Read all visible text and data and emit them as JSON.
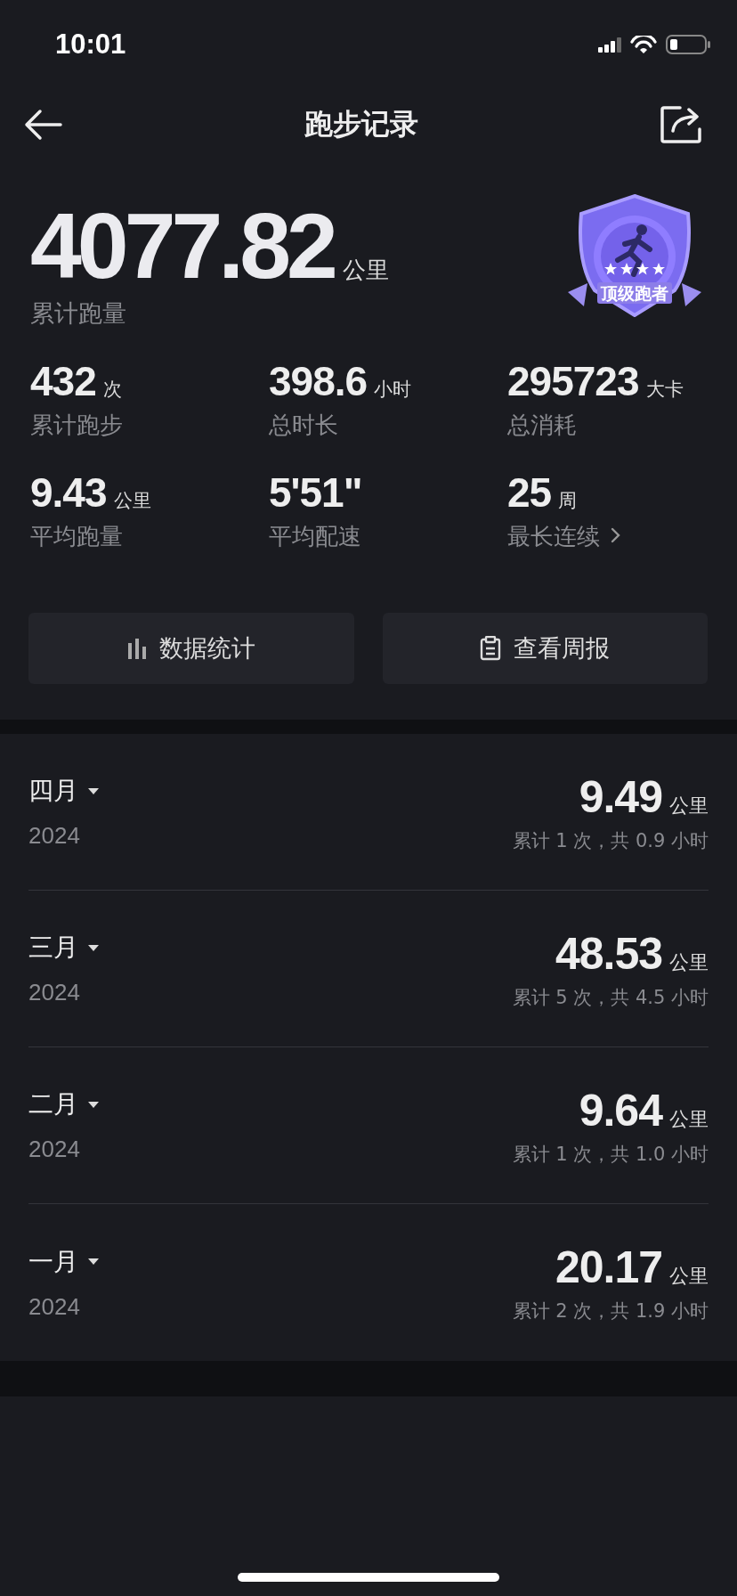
{
  "status_bar": {
    "time": "10:01"
  },
  "header": {
    "title": "跑步记录"
  },
  "summary": {
    "total": "4077.82",
    "unit": "公里",
    "label": "累计跑量",
    "badge": {
      "text": "顶级跑者"
    }
  },
  "stats": [
    {
      "value": "432",
      "unit": "次",
      "label": "累计跑步",
      "kind": "plain"
    },
    {
      "value": "398.6",
      "unit": "小时",
      "label": "总时长",
      "kind": "plain"
    },
    {
      "value": "295723",
      "unit": "大卡",
      "label": "总消耗",
      "kind": "plain"
    },
    {
      "value": "9.43",
      "unit": "公里",
      "label": "平均跑量",
      "kind": "plain"
    },
    {
      "value": "5'51\"",
      "label": "平均配速",
      "kind": "plain"
    },
    {
      "value": "25",
      "unit": "周",
      "label": "最长连续",
      "kind": "link"
    }
  ],
  "actions": [
    {
      "label": "数据统计",
      "kind": "chart"
    },
    {
      "label": "查看周报",
      "kind": "report"
    }
  ],
  "months": [
    {
      "month": "四月",
      "year": "2024",
      "distance": "9.49",
      "unit": "公里",
      "summary": "累计 1 次，共 0.9 小时"
    },
    {
      "month": "三月",
      "year": "2024",
      "distance": "48.53",
      "unit": "公里",
      "summary": "累计 5 次，共 4.5 小时"
    },
    {
      "month": "二月",
      "year": "2024",
      "distance": "9.64",
      "unit": "公里",
      "summary": "累计 1 次，共 1.0 小时"
    },
    {
      "month": "一月",
      "year": "2024",
      "distance": "20.17",
      "unit": "公里",
      "summary": "累计 2 次，共 1.9 小时"
    }
  ]
}
